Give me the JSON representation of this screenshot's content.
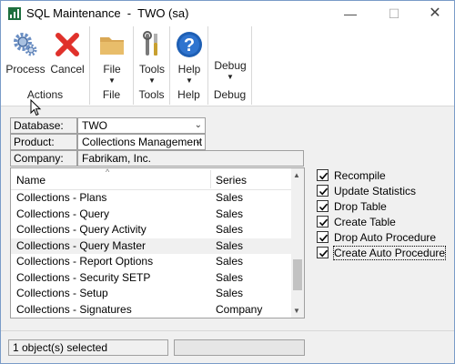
{
  "window": {
    "title": "SQL Maintenance  -  TWO (sa)"
  },
  "ribbon": {
    "actions": {
      "process_label": "Process",
      "cancel_label": "Cancel",
      "group_label": "Actions"
    },
    "file": {
      "label": "File",
      "group_label": "File"
    },
    "tools": {
      "label": "Tools",
      "group_label": "Tools"
    },
    "help": {
      "label": "Help",
      "group_label": "Help"
    },
    "debug": {
      "label": "Debug",
      "group_label": "Debug"
    }
  },
  "form": {
    "database": {
      "label": "Database:",
      "value": "TWO"
    },
    "product": {
      "label": "Product:",
      "value": "Collections Management"
    },
    "company": {
      "label": "Company:",
      "value": "Fabrikam, Inc."
    }
  },
  "list": {
    "columns": {
      "name": "Name",
      "series": "Series"
    },
    "rows": [
      {
        "name": "Collections - Plans",
        "series": "Sales"
      },
      {
        "name": "Collections - Query",
        "series": "Sales"
      },
      {
        "name": "Collections - Query Activity",
        "series": "Sales"
      },
      {
        "name": "Collections - Query Master",
        "series": "Sales"
      },
      {
        "name": "Collections - Report Options",
        "series": "Sales"
      },
      {
        "name": "Collections - Security SETP",
        "series": "Sales"
      },
      {
        "name": "Collections - Setup",
        "series": "Sales"
      },
      {
        "name": "Collections - Signatures",
        "series": "Company"
      }
    ]
  },
  "options": [
    {
      "label": "Recompile",
      "checked": true
    },
    {
      "label": "Update Statistics",
      "checked": true
    },
    {
      "label": "Drop Table",
      "checked": true
    },
    {
      "label": "Create Table",
      "checked": true
    },
    {
      "label": "Drop Auto Procedure",
      "checked": true
    },
    {
      "label": "Create Auto Procedure",
      "checked": true
    }
  ],
  "status": {
    "text": "1 object(s) selected"
  },
  "colors": {
    "accent_blue": "#1e5fb4",
    "cancel_red": "#e0312b",
    "folder_tan": "#d9a855"
  },
  "icons": [
    "gear-icon",
    "cancel-x-icon",
    "folder-icon",
    "tools-icon",
    "help-icon"
  ]
}
